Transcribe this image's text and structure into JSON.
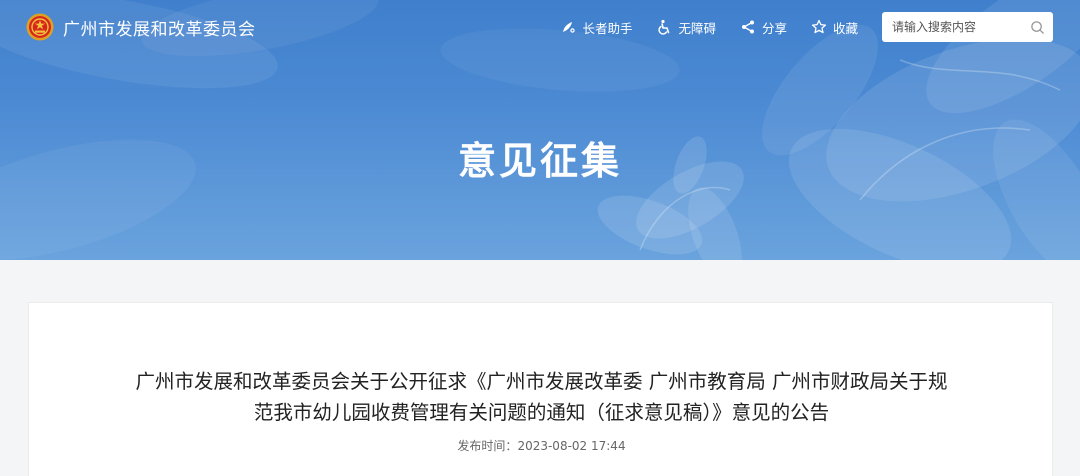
{
  "header": {
    "site_name": "广州市发展和改革委员会",
    "tools": [
      {
        "label": "长者助手",
        "icon": "elder-assist-icon"
      },
      {
        "label": "无障碍",
        "icon": "accessibility-icon"
      },
      {
        "label": "分享",
        "icon": "share-icon"
      },
      {
        "label": "收藏",
        "icon": "star-icon"
      }
    ],
    "search": {
      "placeholder": "请输入搜索内容",
      "value": ""
    }
  },
  "banner": {
    "title": "意见征集"
  },
  "article": {
    "title_line1": "广州市发展和改革委员会关于公开征求《广州市发展改革委 广州市教育局 广州市财政局关于规",
    "title_line2": "范我市幼儿园收费管理有关问题的通知（征求意见稿）》意见的公告",
    "published_label": "发布时间：",
    "published_date": "2023-08-02 17:44"
  },
  "colors": {
    "banner_blue": "#4c8ad3",
    "text_dark": "#222222",
    "text_meta": "#666666"
  }
}
